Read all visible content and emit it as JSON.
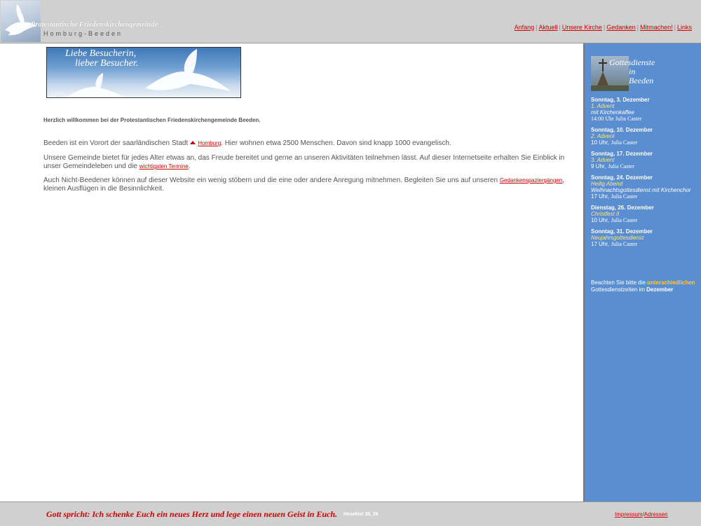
{
  "header": {
    "site_name": "Protestantische Friedenskirchengemeinde",
    "site_sub": "Homburg-Beeden",
    "nav": [
      {
        "label": "Anfang"
      },
      {
        "label": "Aktuell"
      },
      {
        "label": "Unsere Kirche"
      },
      {
        "label": "Gedanken"
      },
      {
        "label": "Mitmachen!"
      },
      {
        "label": "Links"
      }
    ]
  },
  "banner": {
    "line1": "Liebe Besucherin,",
    "line2": "lieber Besucher."
  },
  "main": {
    "welcome": "Herzlich willkommen bei der Protestantischen Friedenskirchengemeinde Beeden.",
    "p1_before": "Beeden ist ein Vorort der saarländischen Stadt",
    "p1_link": "Homburg",
    "p1_after": ". Hier wohnen etwa 2500 Menschen. Davon sind knapp 1000 evangelisch.",
    "p2_before": "Unsere Gemeinde bietet für jedes Alter etwas an, das Freude bereitet und gerne an unseren Aktivitäten teilnehmen lässt. Auf dieser Internetseite erhalten Sie Einblick in unser Gemeindeleben und die",
    "p2_link": "wichtigsten Termine",
    "p2_after": ".",
    "p3_before": "Auch Nicht-Beedener können auf dieser Website ein wenig stöbern und die eine oder andere Anregung mitnehmen. Begleiten Sie uns auf unseren",
    "p3_link": "Gedankenspaziergängen",
    "p3_after": ", kleinen Ausflügen in die Besinnlichkeit."
  },
  "sidebar": {
    "title_line1": "Gottesdienste",
    "title_line2": "in",
    "title_line3": "Beeden",
    "events": [
      {
        "date": "Sonntag, 3. Dezember",
        "name": "1. Advent",
        "desc": "mit Kirchenkaffee",
        "time": "14:00 Uhr",
        "who": "Julia Caster"
      },
      {
        "date": "Sonntag, 10. Dezember",
        "name": "2. Advent",
        "desc": "",
        "time": "10 Uhr,",
        "who": "Julia Caster"
      },
      {
        "date": "Sonntag, 17. Dezember",
        "name": "3. Advent",
        "desc": "",
        "time": "9 Uhr,",
        "who": "Julia Caster"
      },
      {
        "date": "Sonntag, 24. Dezember",
        "name": "Heilig Abend",
        "desc": "Weihnachtsgottesdienst mit Kirchenchor",
        "time": "17 Uhr,",
        "who": "Julia Caster"
      },
      {
        "date": "Dienstag, 26. Dezember",
        "name": "Christfest II",
        "desc": "",
        "time": "10 Uhr,",
        "who": "Julia Caster"
      },
      {
        "date": "Sonntag, 31. Dezember",
        "name": "Neujahrsgottesdienst",
        "desc": "",
        "time": "17 Uhr,",
        "who": "Julia Caster"
      }
    ],
    "notice_before": "Beachten Sie bitte die",
    "notice_highlight": "unterschiedlichen",
    "notice_mid": "Gottesdienstzeiten im",
    "notice_bold": "Dezember"
  },
  "footer": {
    "quote": "Gott spricht: Ich schenke Euch ein neues Herz und lege einen neuen Geist in Euch.",
    "quote_ref": "Hesekiel 36, 26",
    "link_impressum": "Impressum",
    "separator": "/",
    "link_adressen": "Adressen"
  },
  "colors": {
    "accent_link": "#cc0000",
    "sidebar_bg": "#5a8ed0",
    "chrome_bg": "#d0d0d0",
    "event_highlight": "#ffe58a"
  }
}
